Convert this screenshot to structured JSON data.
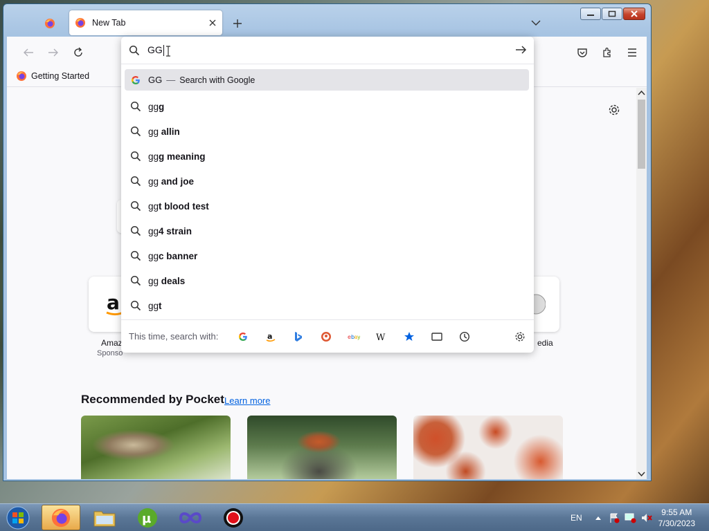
{
  "tabs": {
    "active_title": "New Tab"
  },
  "bookmarks": [
    {
      "label": "Getting Started"
    }
  ],
  "urlbar": {
    "value": "GG"
  },
  "suggestions": {
    "search_row": {
      "query": "GG",
      "separator": "—",
      "action": "Search with Google"
    },
    "items": [
      {
        "plain": "gg",
        "bold": "g"
      },
      {
        "plain": "gg",
        "bold": " allin"
      },
      {
        "plain": "gg",
        "bold": "g meaning"
      },
      {
        "plain": "gg",
        "bold": " and joe"
      },
      {
        "plain": "gg",
        "bold": "t blood test"
      },
      {
        "plain": "gg",
        "bold": "4 strain"
      },
      {
        "plain": "gg",
        "bold": "c banner"
      },
      {
        "plain": "gg",
        "bold": " deals"
      },
      {
        "plain": "gg",
        "bold": "t"
      }
    ]
  },
  "one_off": {
    "label": "This time, search with:",
    "engines": [
      "google-icon",
      "amazon-icon",
      "bing-icon",
      "duckduckgo-icon",
      "ebay-icon",
      "wikipedia-icon",
      "bookmarks-icon",
      "tabs-icon",
      "history-icon"
    ]
  },
  "shortcuts": {
    "left": {
      "label": "Amaz",
      "sub": "Sponso"
    },
    "right": {
      "label": "edia"
    }
  },
  "pocket": {
    "heading": "Recommended by Pocket",
    "link": "Learn more"
  },
  "taskbar": {
    "lang": "EN",
    "time": "9:55 AM",
    "date": "7/30/2023"
  },
  "colors": {
    "accent": "#0061e0",
    "highlight": "#e4e4e8"
  }
}
